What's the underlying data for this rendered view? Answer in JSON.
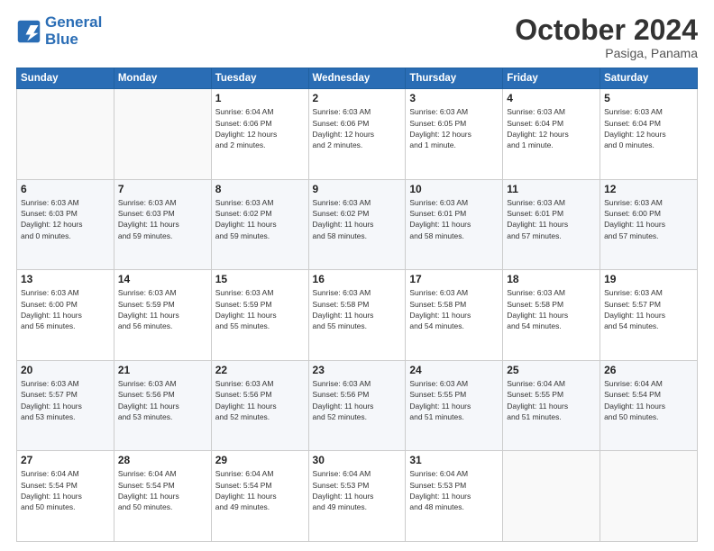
{
  "header": {
    "logo_line1": "General",
    "logo_line2": "Blue",
    "month_title": "October 2024",
    "location": "Pasiga, Panama"
  },
  "days_of_week": [
    "Sunday",
    "Monday",
    "Tuesday",
    "Wednesday",
    "Thursday",
    "Friday",
    "Saturday"
  ],
  "weeks": [
    [
      {
        "day": "",
        "info": ""
      },
      {
        "day": "",
        "info": ""
      },
      {
        "day": "1",
        "info": "Sunrise: 6:04 AM\nSunset: 6:06 PM\nDaylight: 12 hours\nand 2 minutes."
      },
      {
        "day": "2",
        "info": "Sunrise: 6:03 AM\nSunset: 6:06 PM\nDaylight: 12 hours\nand 2 minutes."
      },
      {
        "day": "3",
        "info": "Sunrise: 6:03 AM\nSunset: 6:05 PM\nDaylight: 12 hours\nand 1 minute."
      },
      {
        "day": "4",
        "info": "Sunrise: 6:03 AM\nSunset: 6:04 PM\nDaylight: 12 hours\nand 1 minute."
      },
      {
        "day": "5",
        "info": "Sunrise: 6:03 AM\nSunset: 6:04 PM\nDaylight: 12 hours\nand 0 minutes."
      }
    ],
    [
      {
        "day": "6",
        "info": "Sunrise: 6:03 AM\nSunset: 6:03 PM\nDaylight: 12 hours\nand 0 minutes."
      },
      {
        "day": "7",
        "info": "Sunrise: 6:03 AM\nSunset: 6:03 PM\nDaylight: 11 hours\nand 59 minutes."
      },
      {
        "day": "8",
        "info": "Sunrise: 6:03 AM\nSunset: 6:02 PM\nDaylight: 11 hours\nand 59 minutes."
      },
      {
        "day": "9",
        "info": "Sunrise: 6:03 AM\nSunset: 6:02 PM\nDaylight: 11 hours\nand 58 minutes."
      },
      {
        "day": "10",
        "info": "Sunrise: 6:03 AM\nSunset: 6:01 PM\nDaylight: 11 hours\nand 58 minutes."
      },
      {
        "day": "11",
        "info": "Sunrise: 6:03 AM\nSunset: 6:01 PM\nDaylight: 11 hours\nand 57 minutes."
      },
      {
        "day": "12",
        "info": "Sunrise: 6:03 AM\nSunset: 6:00 PM\nDaylight: 11 hours\nand 57 minutes."
      }
    ],
    [
      {
        "day": "13",
        "info": "Sunrise: 6:03 AM\nSunset: 6:00 PM\nDaylight: 11 hours\nand 56 minutes."
      },
      {
        "day": "14",
        "info": "Sunrise: 6:03 AM\nSunset: 5:59 PM\nDaylight: 11 hours\nand 56 minutes."
      },
      {
        "day": "15",
        "info": "Sunrise: 6:03 AM\nSunset: 5:59 PM\nDaylight: 11 hours\nand 55 minutes."
      },
      {
        "day": "16",
        "info": "Sunrise: 6:03 AM\nSunset: 5:58 PM\nDaylight: 11 hours\nand 55 minutes."
      },
      {
        "day": "17",
        "info": "Sunrise: 6:03 AM\nSunset: 5:58 PM\nDaylight: 11 hours\nand 54 minutes."
      },
      {
        "day": "18",
        "info": "Sunrise: 6:03 AM\nSunset: 5:58 PM\nDaylight: 11 hours\nand 54 minutes."
      },
      {
        "day": "19",
        "info": "Sunrise: 6:03 AM\nSunset: 5:57 PM\nDaylight: 11 hours\nand 54 minutes."
      }
    ],
    [
      {
        "day": "20",
        "info": "Sunrise: 6:03 AM\nSunset: 5:57 PM\nDaylight: 11 hours\nand 53 minutes."
      },
      {
        "day": "21",
        "info": "Sunrise: 6:03 AM\nSunset: 5:56 PM\nDaylight: 11 hours\nand 53 minutes."
      },
      {
        "day": "22",
        "info": "Sunrise: 6:03 AM\nSunset: 5:56 PM\nDaylight: 11 hours\nand 52 minutes."
      },
      {
        "day": "23",
        "info": "Sunrise: 6:03 AM\nSunset: 5:56 PM\nDaylight: 11 hours\nand 52 minutes."
      },
      {
        "day": "24",
        "info": "Sunrise: 6:03 AM\nSunset: 5:55 PM\nDaylight: 11 hours\nand 51 minutes."
      },
      {
        "day": "25",
        "info": "Sunrise: 6:04 AM\nSunset: 5:55 PM\nDaylight: 11 hours\nand 51 minutes."
      },
      {
        "day": "26",
        "info": "Sunrise: 6:04 AM\nSunset: 5:54 PM\nDaylight: 11 hours\nand 50 minutes."
      }
    ],
    [
      {
        "day": "27",
        "info": "Sunrise: 6:04 AM\nSunset: 5:54 PM\nDaylight: 11 hours\nand 50 minutes."
      },
      {
        "day": "28",
        "info": "Sunrise: 6:04 AM\nSunset: 5:54 PM\nDaylight: 11 hours\nand 50 minutes."
      },
      {
        "day": "29",
        "info": "Sunrise: 6:04 AM\nSunset: 5:54 PM\nDaylight: 11 hours\nand 49 minutes."
      },
      {
        "day": "30",
        "info": "Sunrise: 6:04 AM\nSunset: 5:53 PM\nDaylight: 11 hours\nand 49 minutes."
      },
      {
        "day": "31",
        "info": "Sunrise: 6:04 AM\nSunset: 5:53 PM\nDaylight: 11 hours\nand 48 minutes."
      },
      {
        "day": "",
        "info": ""
      },
      {
        "day": "",
        "info": ""
      }
    ]
  ]
}
